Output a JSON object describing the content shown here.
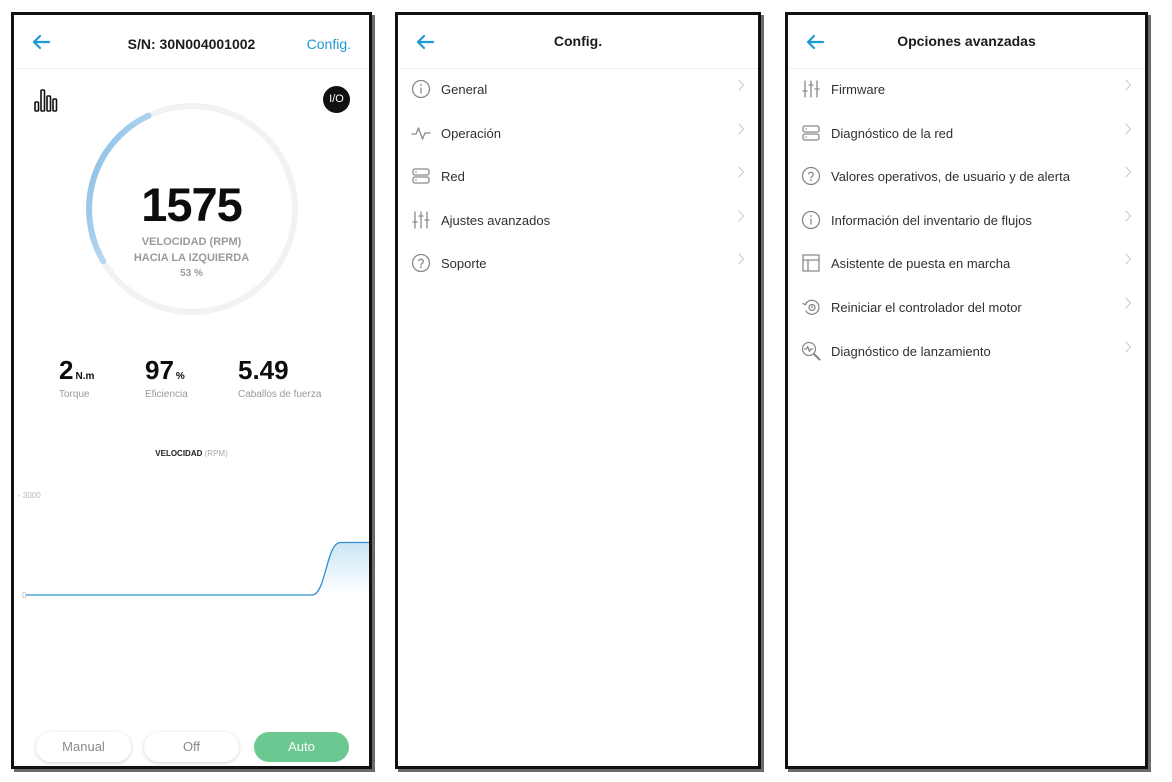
{
  "status_screen": {
    "serial": "S/N: 30N004001002",
    "config_link": "Config.",
    "io_button": "I/O",
    "gauge": {
      "value": "1575",
      "line1": "VELOCIDAD (RPM)",
      "line2": "HACIA LA IZQUIERDA",
      "percent_text": "53 %",
      "fill_fraction": 0.53
    },
    "metrics": [
      {
        "value": "2",
        "unit": "N.m",
        "label": "Torque"
      },
      {
        "value": "97",
        "unit": "%",
        "label": "Eficiencia"
      },
      {
        "value": "5.49",
        "unit": "",
        "label": "Caballos de fuerza"
      }
    ],
    "chart_title_bold": "VELOCIDAD",
    "chart_title_muted": "(RPM)",
    "modes": {
      "manual": "Manual",
      "off": "Off",
      "auto": "Auto",
      "active": "Auto"
    }
  },
  "chart_data": {
    "type": "area",
    "title": "VELOCIDAD (RPM)",
    "ytick_labels": [
      "- 3000",
      "0"
    ],
    "ylim": [
      0,
      3000
    ],
    "x": [
      0,
      1,
      2,
      3,
      4,
      5,
      6,
      7,
      8,
      9,
      10,
      11,
      12
    ],
    "y": [
      0,
      0,
      0,
      0,
      0,
      0,
      0,
      0,
      0,
      0,
      0,
      1575,
      1575
    ]
  },
  "config_screen": {
    "title": "Config.",
    "items": [
      {
        "label": "General",
        "icon": "info-icon"
      },
      {
        "label": "Operación",
        "icon": "pulse-icon"
      },
      {
        "label": "Red",
        "icon": "server-icon"
      },
      {
        "label": "Ajustes avanzados",
        "icon": "sliders-icon"
      },
      {
        "label": "Soporte",
        "icon": "help-icon"
      }
    ]
  },
  "advanced_screen": {
    "title": "Opciones avanzadas",
    "items": [
      {
        "label": "Firmware",
        "icon": "sliders-icon"
      },
      {
        "label": "Diagnóstico de la red",
        "icon": "server-icon"
      },
      {
        "label": "Valores operativos, de usuario y de alerta",
        "icon": "help-icon"
      },
      {
        "label": "Información del inventario de flujos",
        "icon": "info-icon"
      },
      {
        "label": "Asistente de puesta en marcha",
        "icon": "layout-icon"
      },
      {
        "label": "Reiniciar el controlador del motor",
        "icon": "restart-icon"
      },
      {
        "label": "Diagnóstico de lanzamiento",
        "icon": "search-pulse-icon"
      }
    ]
  },
  "colors": {
    "accent": "#1d9ad6",
    "gauge_arc": "#8fc3e8",
    "gauge_track": "#f0f2f4",
    "auto_green": "#6cc891",
    "chart_line": "#2f8fd0",
    "chart_fill": "#cbe5f6"
  }
}
